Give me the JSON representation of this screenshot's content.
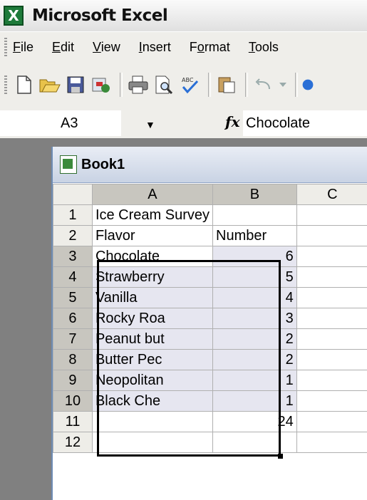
{
  "app": {
    "title": "Microsoft Excel",
    "icon_letter": "X"
  },
  "menu": [
    "File",
    "Edit",
    "View",
    "Insert",
    "Format",
    "Tools"
  ],
  "menu_accel": [
    "F",
    "E",
    "V",
    "I",
    "o",
    "T"
  ],
  "toolbar": {
    "icons": [
      "new-icon",
      "open-icon",
      "save-icon",
      "permission-icon",
      "print-icon",
      "print-preview-icon",
      "spelling-icon",
      "paste-icon",
      "undo-icon",
      "undo-dropdown-icon",
      "help-icon"
    ]
  },
  "formula_bar": {
    "name_box": "A3",
    "fx_label": "fx",
    "value": "Chocolate"
  },
  "workbook": {
    "title": "Book1",
    "columns": [
      "A",
      "B",
      "C"
    ],
    "rows": [
      {
        "n": "1",
        "a": "Ice Cream Survey",
        "b": ""
      },
      {
        "n": "2",
        "a": "Flavor",
        "b": "Number"
      },
      {
        "n": "3",
        "a": "Chocolate",
        "b": "6"
      },
      {
        "n": "4",
        "a": "Strawberry",
        "b": "5"
      },
      {
        "n": "5",
        "a": "Vanilla",
        "b": "4"
      },
      {
        "n": "6",
        "a": "Rocky Roa",
        "b": "3"
      },
      {
        "n": "7",
        "a": "Peanut but",
        "b": "2"
      },
      {
        "n": "8",
        "a": "Butter Pec",
        "b": "2"
      },
      {
        "n": "9",
        "a": "Neopolitan",
        "b": "1"
      },
      {
        "n": "10",
        "a": "Black Che",
        "b": "1"
      },
      {
        "n": "11",
        "a": "",
        "b": "24"
      },
      {
        "n": "12",
        "a": "",
        "b": ""
      }
    ]
  },
  "colors": {
    "selection_fill": "#e6e6f0",
    "header_selected": "#c8c6bf",
    "excel_green": "#1e7a3a"
  }
}
